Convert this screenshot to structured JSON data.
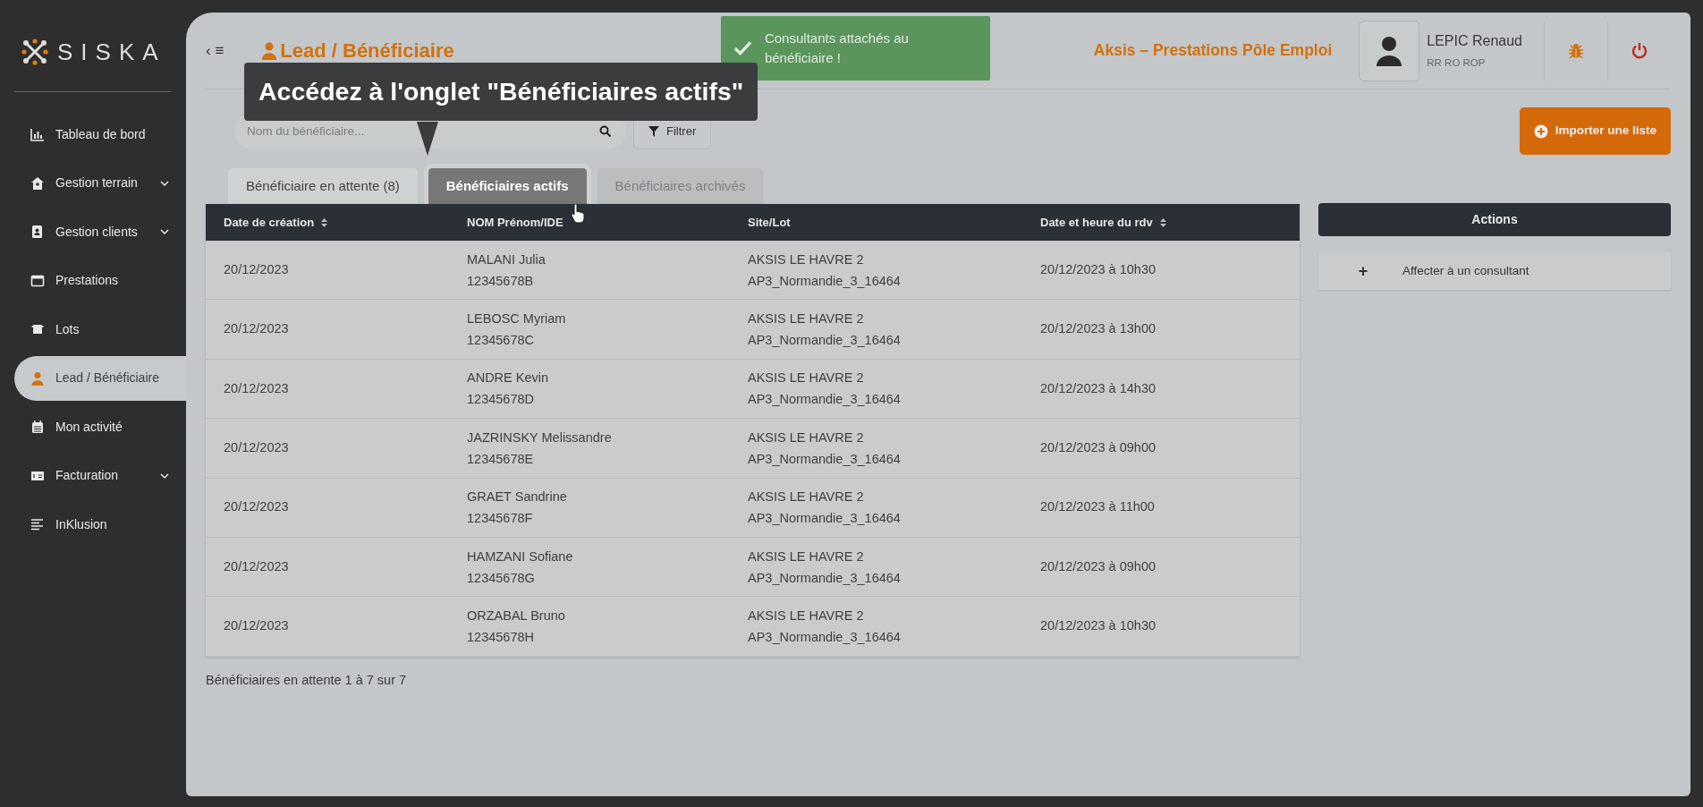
{
  "sidebar": {
    "logo": "SISKA",
    "items": [
      {
        "label": "Tableau de bord",
        "expandable": false,
        "selected": false
      },
      {
        "label": "Gestion terrain",
        "expandable": true,
        "selected": false
      },
      {
        "label": "Gestion clients",
        "expandable": true,
        "selected": false
      },
      {
        "label": "Prestations",
        "expandable": false,
        "selected": false
      },
      {
        "label": "Lots",
        "expandable": false,
        "selected": false
      },
      {
        "label": "Lead / Bénéficiaire",
        "expandable": false,
        "selected": true
      },
      {
        "label": "Mon activité",
        "expandable": false,
        "selected": false
      },
      {
        "label": "Facturation",
        "expandable": true,
        "selected": false
      },
      {
        "label": "InKlusion",
        "expandable": false,
        "selected": false
      }
    ]
  },
  "header": {
    "toggle": "‹ ≡",
    "title": "Lead / Bénéficiaire",
    "organization": "Aksis – Prestations Pôle Emploi",
    "user": {
      "name": "LEPIC Renaud",
      "role": "RR RO ROP"
    }
  },
  "toast": {
    "message": "Consultants attachés au bénéficiaire !"
  },
  "search": {
    "placeholder": "Nom du bénéficiaire..."
  },
  "filter_button": "Filtrer",
  "import_button": "Importer une liste",
  "tabs": [
    {
      "label": "Bénéficiaire en attente (8)",
      "selected": false,
      "disabled": false
    },
    {
      "label": "Bénéficiaires actifs",
      "selected": true,
      "disabled": false
    },
    {
      "label": "Bénéficiaires archivés",
      "selected": false,
      "disabled": true
    }
  ],
  "tooltip": "Accédez à l'onglet \"Bénéficiaires actifs\"",
  "table": {
    "columns": [
      {
        "label": "Date de création",
        "sortable": true
      },
      {
        "label": "NOM Prénom/IDE",
        "sortable": false
      },
      {
        "label": "Site/Lot",
        "sortable": false
      },
      {
        "label": "Date et heure du rdv",
        "sortable": true
      }
    ],
    "rows": [
      {
        "created": "20/12/2023",
        "name": "MALANI Julia",
        "ide": "12345678B",
        "site": "AKSIS LE HAVRE 2",
        "lot": "AP3_Normandie_3_16464",
        "appointment": "20/12/2023 à 10h30"
      },
      {
        "created": "20/12/2023",
        "name": "LEBOSC Myriam",
        "ide": "12345678C",
        "site": "AKSIS LE HAVRE 2",
        "lot": "AP3_Normandie_3_16464",
        "appointment": "20/12/2023 à 13h00"
      },
      {
        "created": "20/12/2023",
        "name": "ANDRE Kevin",
        "ide": "12345678D",
        "site": "AKSIS LE HAVRE 2",
        "lot": "AP3_Normandie_3_16464",
        "appointment": "20/12/2023 à 14h30"
      },
      {
        "created": "20/12/2023",
        "name": "JAZRINSKY Melissandre",
        "ide": "12345678E",
        "site": "AKSIS LE HAVRE 2",
        "lot": "AP3_Normandie_3_16464",
        "appointment": "20/12/2023 à 09h00"
      },
      {
        "created": "20/12/2023",
        "name": "GRAET Sandrine",
        "ide": "12345678F",
        "site": "AKSIS LE HAVRE 2",
        "lot": "AP3_Normandie_3_16464",
        "appointment": "20/12/2023 à 11h00"
      },
      {
        "created": "20/12/2023",
        "name": "HAMZANI Sofiane",
        "ide": "12345678G",
        "site": "AKSIS LE HAVRE 2",
        "lot": "AP3_Normandie_3_16464",
        "appointment": "20/12/2023 à 09h00"
      },
      {
        "created": "20/12/2023",
        "name": "ORZABAL Bruno",
        "ide": "12345678H",
        "site": "AKSIS LE HAVRE 2",
        "lot": "AP3_Normandie_3_16464",
        "appointment": "20/12/2023 à 10h30"
      }
    ]
  },
  "pagination": "Bénéficiaires en attente 1 à 7 sur 7",
  "actions": {
    "title": "Actions",
    "items": [
      {
        "icon": "+",
        "label": "Affecter à un consultant"
      }
    ]
  }
}
